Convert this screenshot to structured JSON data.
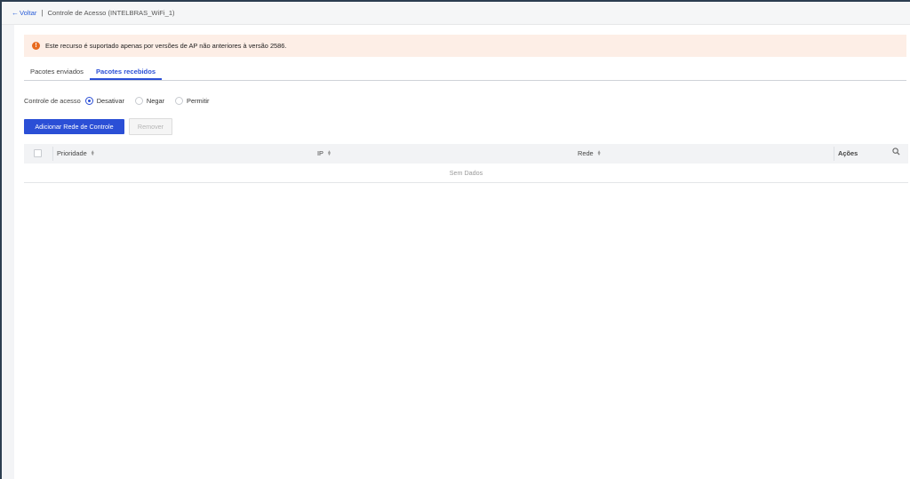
{
  "header": {
    "back_label": "Voltar",
    "separator": "|",
    "title": "Controle de Acesso (INTELBRAS_WiFi_1)"
  },
  "alert": {
    "text": "Este recurso é suportado apenas por versões de AP não anteriores à versão 2586.",
    "color": "#e86a1f"
  },
  "tabs": [
    {
      "label": "Pacotes enviados",
      "active": false
    },
    {
      "label": "Pacotes recebidos",
      "active": true
    }
  ],
  "access_control": {
    "label": "Controle de acesso",
    "options": [
      {
        "label": "Desativar",
        "checked": true
      },
      {
        "label": "Negar",
        "checked": false
      },
      {
        "label": "Permitir",
        "checked": false
      }
    ]
  },
  "buttons": {
    "add": "Adicionar Rede de Controle",
    "remove": "Remover"
  },
  "table": {
    "columns": [
      "Prioridade",
      "IP",
      "Rede",
      "Ações"
    ],
    "empty_text": "Sem Dados"
  },
  "colors": {
    "accent": "#2b4fd6",
    "alert_bg": "#fdeee6"
  }
}
